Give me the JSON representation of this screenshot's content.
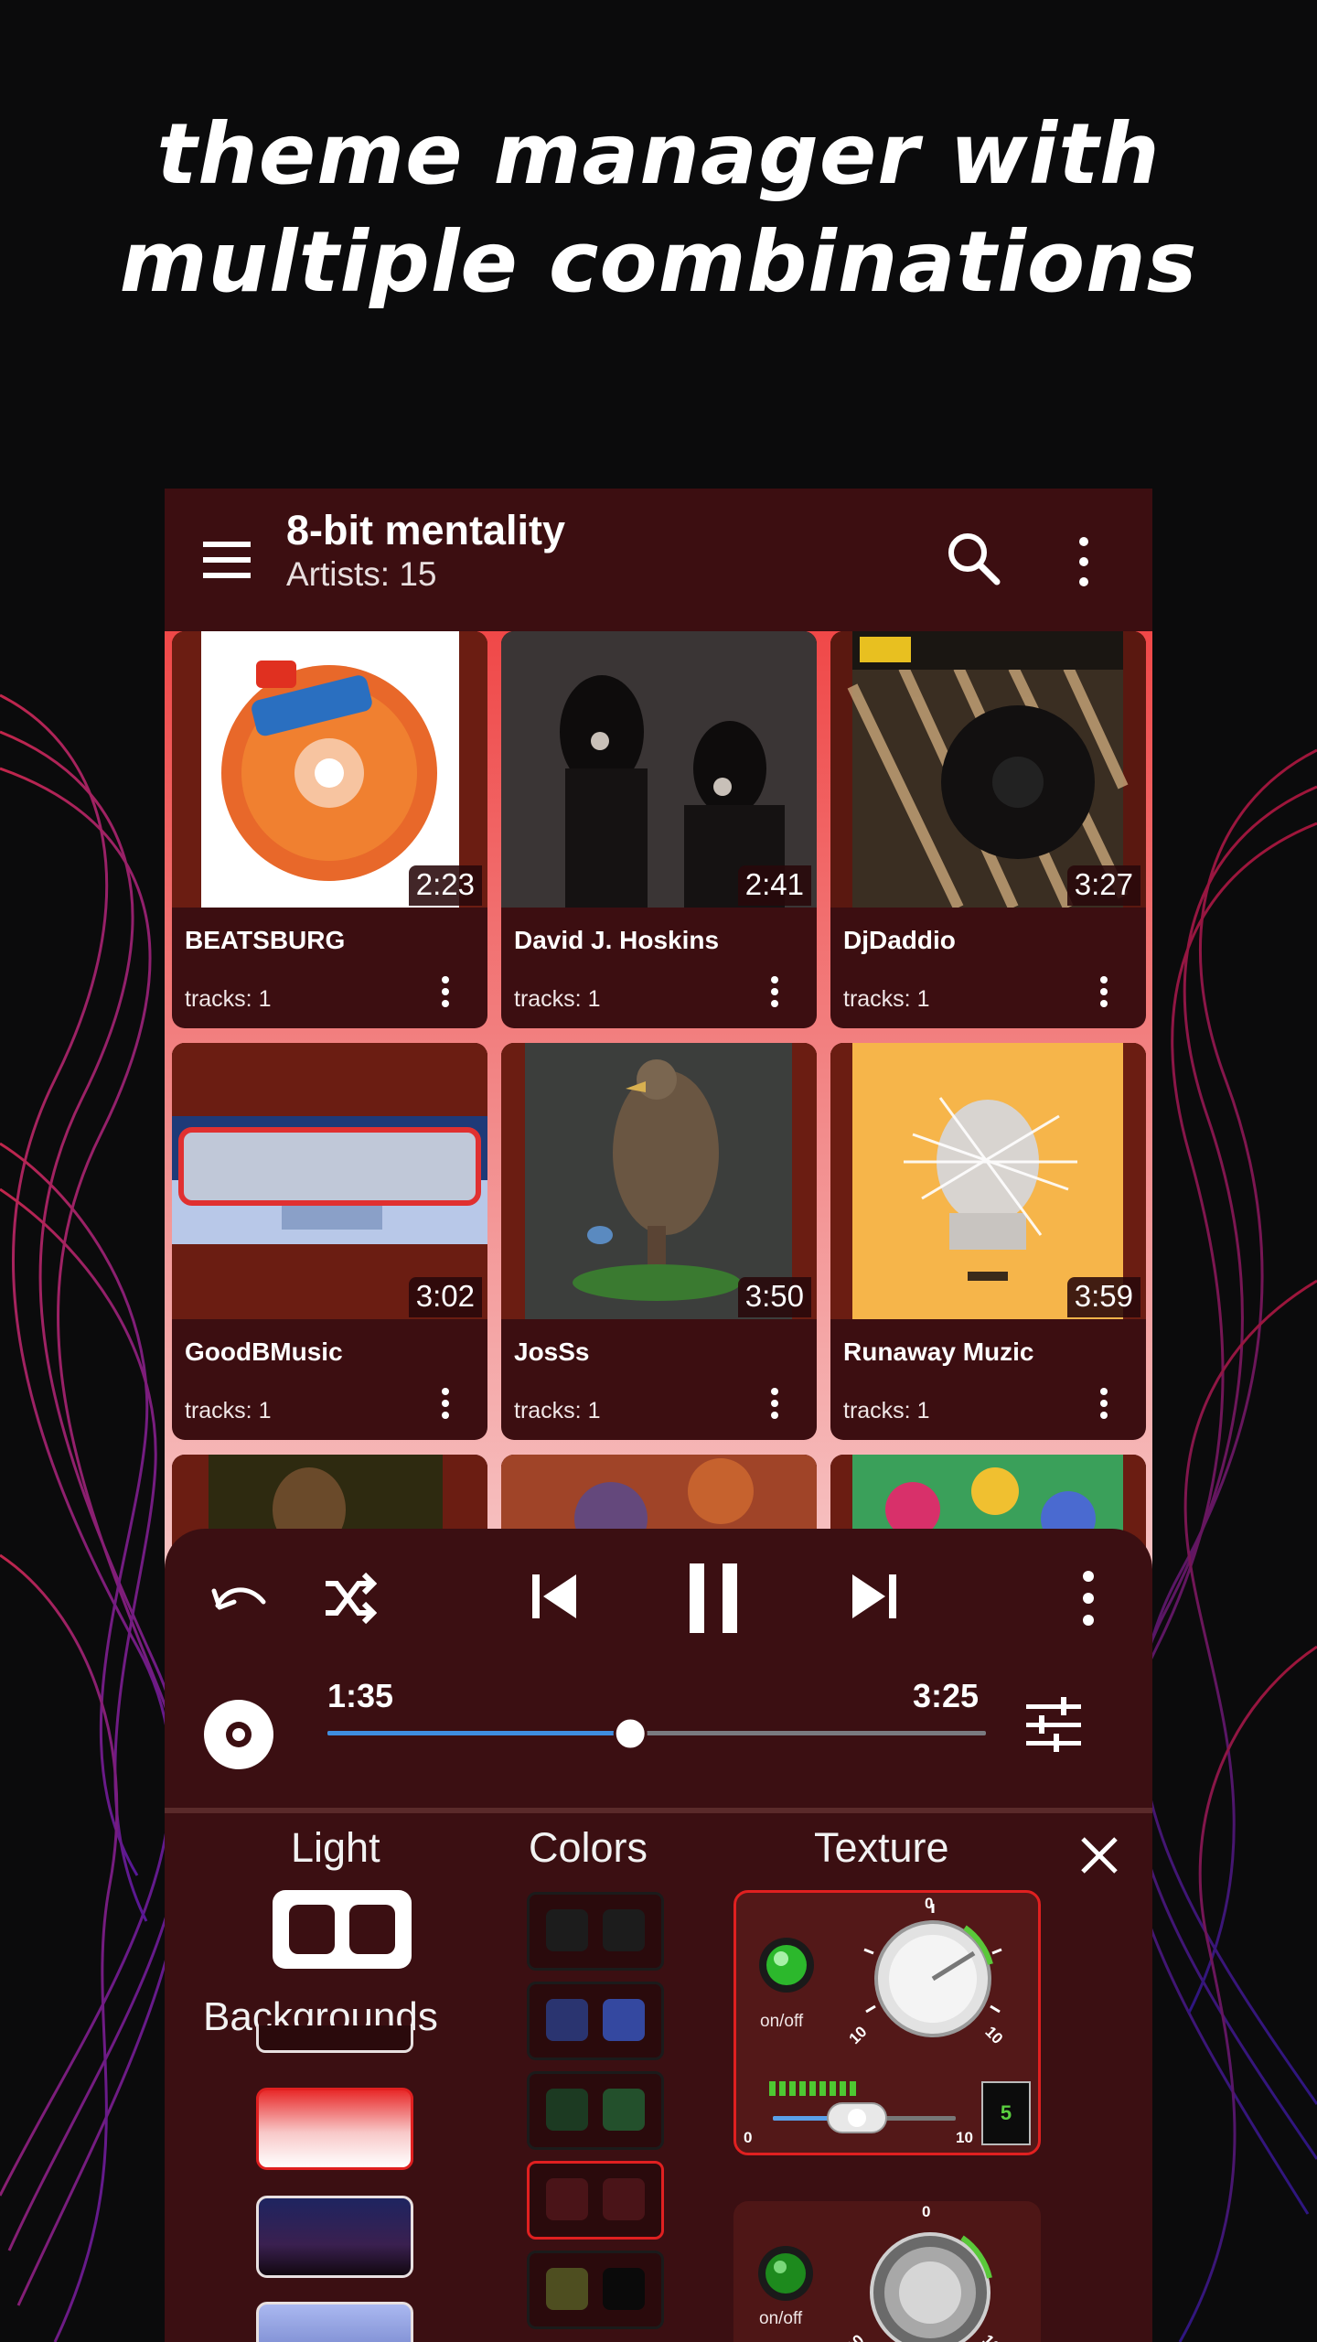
{
  "headline": {
    "line1": "theme manager with",
    "line2": "multiple combinations"
  },
  "appbar": {
    "title": "8-bit mentality",
    "subtitle": "Artists: 15"
  },
  "artists": [
    {
      "name": "BEATSBURG",
      "tracks": "tracks: 1",
      "duration": "2:23"
    },
    {
      "name": "David J. Hoskins",
      "tracks": "tracks: 1",
      "duration": "2:41"
    },
    {
      "name": "DjDaddio",
      "tracks": "tracks: 1",
      "duration": "3:27"
    },
    {
      "name": "GoodBMusic",
      "tracks": "tracks: 1",
      "duration": "3:02"
    },
    {
      "name": "JosSs",
      "tracks": "tracks: 1",
      "duration": "3:50"
    },
    {
      "name": "Runaway Muzic",
      "tracks": "tracks: 1",
      "duration": "3:59"
    }
  ],
  "player": {
    "elapsed": "1:35",
    "total": "3:25",
    "progress": 0.46
  },
  "theme": {
    "light_label": "Light",
    "colors_label": "Colors",
    "texture_label": "Texture",
    "backgrounds_label": "Backgrounds",
    "onoff_label": "on/off",
    "knob_top": "0",
    "knob_left": "10",
    "knob_right": "10",
    "slider_min": "0",
    "slider_max": "10",
    "slider_value": "5",
    "color_swatches": [
      [
        "#1c1c1c",
        "#1c1c1c"
      ],
      [
        "#2a3470",
        "#3448a0"
      ],
      [
        "#1c3a22",
        "#23502c"
      ],
      [
        "#4a1418",
        "#4a1418"
      ],
      [
        "#4e4e20",
        "#0a0a0a"
      ]
    ]
  }
}
